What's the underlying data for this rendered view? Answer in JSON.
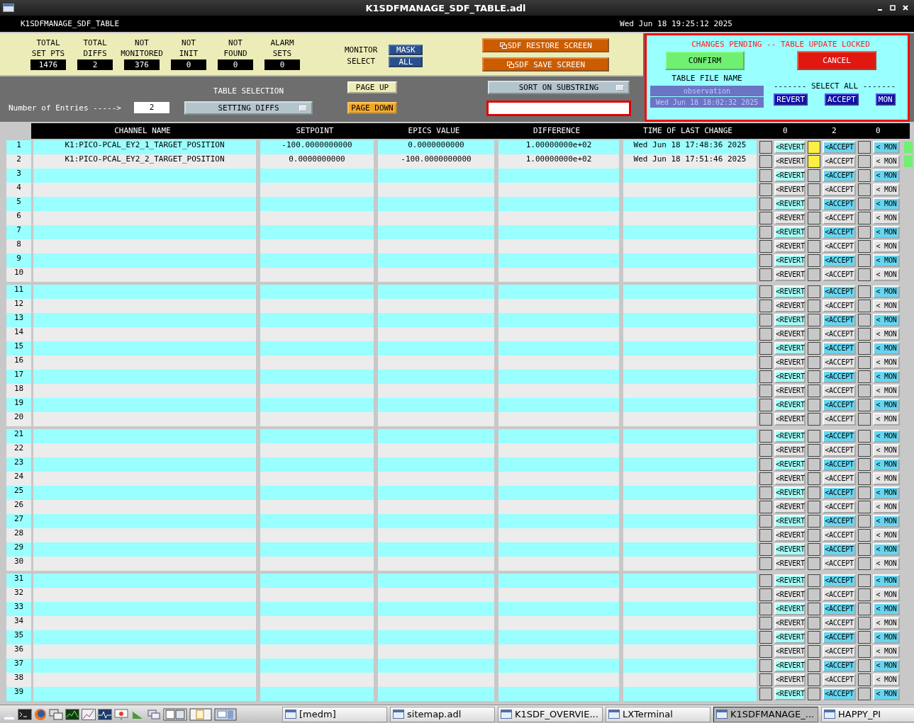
{
  "window": {
    "title": "K1SDFMANAGE_SDF_TABLE.adl"
  },
  "header": {
    "screen_name": "K1SDFMANAGE_SDF_TABLE",
    "clock": "Wed Jun 18 19:25:12 2025"
  },
  "stats": [
    {
      "line1": "TOTAL",
      "line2": "SET PTS",
      "value": "1476"
    },
    {
      "line1": "TOTAL",
      "line2": "DIFFS",
      "value": "2"
    },
    {
      "line1": "NOT",
      "line2": "MONITORED",
      "value": "376"
    },
    {
      "line1": "NOT",
      "line2": "INIT",
      "value": "0"
    },
    {
      "line1": "NOT",
      "line2": "FOUND",
      "value": "0"
    },
    {
      "line1": "ALARM",
      "line2": "SETS",
      "value": "0"
    }
  ],
  "monitor_select": {
    "line1": "MONITOR",
    "line2": "SELECT",
    "buttons": [
      "MASK",
      "ALL"
    ]
  },
  "screen_buttons": [
    "SDF RESTORE SCREEN",
    "SDF SAVE SCREEN"
  ],
  "entries": {
    "label": "Number of Entries ----->",
    "value": "2"
  },
  "table_selection": {
    "label": "TABLE SELECTION",
    "value": "SETTING DIFFS"
  },
  "page_buttons": [
    {
      "label": "PAGE UP",
      "highlighted": false
    },
    {
      "label": "PAGE DOWN",
      "highlighted": true
    }
  ],
  "sort": {
    "label": "SORT ON SUBSTRING"
  },
  "pending": {
    "message": "CHANGES PENDING -- TABLE UPDATE LOCKED",
    "confirm": "CONFIRM",
    "cancel": "CANCEL",
    "file_label": "TABLE FILE NAME",
    "file_name": "observation",
    "file_time": "Wed Jun 18 18:02:32 2025",
    "select_all": "------- SELECT ALL -------",
    "select_buttons": [
      "REVERT",
      "ACCEPT",
      "MON"
    ]
  },
  "table": {
    "columns": [
      "CHANNEL NAME",
      "SETPOINT",
      "EPICS VALUE",
      "DIFFERENCE",
      "TIME OF LAST CHANGE"
    ],
    "counts": [
      "0",
      "2",
      "0"
    ],
    "rows": [
      {
        "num": "1",
        "channel": "K1:PICO-PCAL_EY2_1_TARGET_POSITION",
        "setpoint": "-100.0000000000",
        "epics": "0.0000000000",
        "difference": "1.00000000e+02",
        "time": "Wed Jun 18 17:48:36 2025",
        "revert": "<REVERT",
        "accept": "<ACCEPT",
        "mon": "< MON",
        "revert_checked": false,
        "accept_checked": true,
        "mon_checked": false,
        "status_ok": true
      },
      {
        "num": "2",
        "channel": "K1:PICO-PCAL_EY2_2_TARGET_POSITION",
        "setpoint": "0.0000000000",
        "epics": "-100.0000000000",
        "difference": "1.00000000e+02",
        "time": "Wed Jun 18 17:51:46 2025",
        "revert": "<REVERT",
        "accept": "<ACCEPT",
        "mon": "< MON",
        "revert_checked": false,
        "accept_checked": true,
        "mon_checked": false,
        "status_ok": true
      },
      {
        "num": "3",
        "revert": "<REVERT",
        "accept": "<ACCEPT",
        "mon": "< MON",
        "revert_checked": false,
        "accept_checked": false,
        "mon_checked": false,
        "status_ok": false
      },
      {
        "num": "4",
        "revert": "<REVERT",
        "accept": "<ACCEPT",
        "mon": "< MON",
        "revert_checked": false,
        "accept_checked": false,
        "mon_checked": false,
        "status_ok": false
      },
      {
        "num": "5",
        "revert": "<REVERT",
        "accept": "<ACCEPT",
        "mon": "< MON",
        "revert_checked": false,
        "accept_checked": false,
        "mon_checked": false,
        "status_ok": false
      },
      {
        "num": "6",
        "revert": "<REVERT",
        "accept": "<ACCEPT",
        "mon": "< MON",
        "revert_checked": false,
        "accept_checked": false,
        "mon_checked": false,
        "status_ok": false
      },
      {
        "num": "7",
        "revert": "<REVERT",
        "accept": "<ACCEPT",
        "mon": "< MON",
        "revert_checked": false,
        "accept_checked": false,
        "mon_checked": false,
        "status_ok": false
      },
      {
        "num": "8",
        "revert": "<REVERT",
        "accept": "<ACCEPT",
        "mon": "< MON",
        "revert_checked": false,
        "accept_checked": false,
        "mon_checked": false,
        "status_ok": false
      },
      {
        "num": "9",
        "revert": "<REVERT",
        "accept": "<ACCEPT",
        "mon": "< MON",
        "revert_checked": false,
        "accept_checked": false,
        "mon_checked": false,
        "status_ok": false
      },
      {
        "num": "10",
        "revert": "<REVERT",
        "accept": "<ACCEPT",
        "mon": "< MON",
        "revert_checked": false,
        "accept_checked": false,
        "mon_checked": false,
        "status_ok": false
      },
      {
        "num": "11",
        "revert": "<REVERT",
        "accept": "<ACCEPT",
        "mon": "< MON",
        "revert_checked": false,
        "accept_checked": false,
        "mon_checked": false,
        "status_ok": false
      },
      {
        "num": "12",
        "revert": "<REVERT",
        "accept": "<ACCEPT",
        "mon": "< MON",
        "revert_checked": false,
        "accept_checked": false,
        "mon_checked": false,
        "status_ok": false
      },
      {
        "num": "13",
        "revert": "<REVERT",
        "accept": "<ACCEPT",
        "mon": "< MON",
        "revert_checked": false,
        "accept_checked": false,
        "mon_checked": false,
        "status_ok": false
      },
      {
        "num": "14",
        "revert": "<REVERT",
        "accept": "<ACCEPT",
        "mon": "< MON",
        "revert_checked": false,
        "accept_checked": false,
        "mon_checked": false,
        "status_ok": false
      },
      {
        "num": "15",
        "revert": "<REVERT",
        "accept": "<ACCEPT",
        "mon": "< MON",
        "revert_checked": false,
        "accept_checked": false,
        "mon_checked": false,
        "status_ok": false
      },
      {
        "num": "16",
        "revert": "<REVERT",
        "accept": "<ACCEPT",
        "mon": "< MON",
        "revert_checked": false,
        "accept_checked": false,
        "mon_checked": false,
        "status_ok": false
      },
      {
        "num": "17",
        "revert": "<REVERT",
        "accept": "<ACCEPT",
        "mon": "< MON",
        "revert_checked": false,
        "accept_checked": false,
        "mon_checked": false,
        "status_ok": false
      },
      {
        "num": "18",
        "revert": "<REVERT",
        "accept": "<ACCEPT",
        "mon": "< MON",
        "revert_checked": false,
        "accept_checked": false,
        "mon_checked": false,
        "status_ok": false
      },
      {
        "num": "19",
        "revert": "<REVERT",
        "accept": "<ACCEPT",
        "mon": "< MON",
        "revert_checked": false,
        "accept_checked": false,
        "mon_checked": false,
        "status_ok": false
      },
      {
        "num": "20",
        "revert": "<REVERT",
        "accept": "<ACCEPT",
        "mon": "< MON",
        "revert_checked": false,
        "accept_checked": false,
        "mon_checked": false,
        "status_ok": false
      },
      {
        "num": "21",
        "revert": "<REVERT",
        "accept": "<ACCEPT",
        "mon": "< MON",
        "revert_checked": false,
        "accept_checked": false,
        "mon_checked": false,
        "status_ok": false
      },
      {
        "num": "22",
        "revert": "<REVERT",
        "accept": "<ACCEPT",
        "mon": "< MON",
        "revert_checked": false,
        "accept_checked": false,
        "mon_checked": false,
        "status_ok": false
      },
      {
        "num": "23",
        "revert": "<REVERT",
        "accept": "<ACCEPT",
        "mon": "< MON",
        "revert_checked": false,
        "accept_checked": false,
        "mon_checked": false,
        "status_ok": false
      },
      {
        "num": "24",
        "revert": "<REVERT",
        "accept": "<ACCEPT",
        "mon": "< MON",
        "revert_checked": false,
        "accept_checked": false,
        "mon_checked": false,
        "status_ok": false
      },
      {
        "num": "25",
        "revert": "<REVERT",
        "accept": "<ACCEPT",
        "mon": "< MON",
        "revert_checked": false,
        "accept_checked": false,
        "mon_checked": false,
        "status_ok": false
      },
      {
        "num": "26",
        "revert": "<REVERT",
        "accept": "<ACCEPT",
        "mon": "< MON",
        "revert_checked": false,
        "accept_checked": false,
        "mon_checked": false,
        "status_ok": false
      },
      {
        "num": "27",
        "revert": "<REVERT",
        "accept": "<ACCEPT",
        "mon": "< MON",
        "revert_checked": false,
        "accept_checked": false,
        "mon_checked": false,
        "status_ok": false
      },
      {
        "num": "28",
        "revert": "<REVERT",
        "accept": "<ACCEPT",
        "mon": "< MON",
        "revert_checked": false,
        "accept_checked": false,
        "mon_checked": false,
        "status_ok": false
      },
      {
        "num": "29",
        "revert": "<REVERT",
        "accept": "<ACCEPT",
        "mon": "< MON",
        "revert_checked": false,
        "accept_checked": false,
        "mon_checked": false,
        "status_ok": false
      },
      {
        "num": "30",
        "revert": "<REVERT",
        "accept": "<ACCEPT",
        "mon": "< MON",
        "revert_checked": false,
        "accept_checked": false,
        "mon_checked": false,
        "status_ok": false
      },
      {
        "num": "31",
        "revert": "<REVERT",
        "accept": "<ACCEPT",
        "mon": "< MON",
        "revert_checked": false,
        "accept_checked": false,
        "mon_checked": false,
        "status_ok": false
      },
      {
        "num": "32",
        "revert": "<REVERT",
        "accept": "<ACCEPT",
        "mon": "< MON",
        "revert_checked": false,
        "accept_checked": false,
        "mon_checked": false,
        "status_ok": false
      },
      {
        "num": "33",
        "revert": "<REVERT",
        "accept": "<ACCEPT",
        "mon": "< MON",
        "revert_checked": false,
        "accept_checked": false,
        "mon_checked": false,
        "status_ok": false
      },
      {
        "num": "34",
        "revert": "<REVERT",
        "accept": "<ACCEPT",
        "mon": "< MON",
        "revert_checked": false,
        "accept_checked": false,
        "mon_checked": false,
        "status_ok": false
      },
      {
        "num": "35",
        "revert": "<REVERT",
        "accept": "<ACCEPT",
        "mon": "< MON",
        "revert_checked": false,
        "accept_checked": false,
        "mon_checked": false,
        "status_ok": false
      },
      {
        "num": "36",
        "revert": "<REVERT",
        "accept": "<ACCEPT",
        "mon": "< MON",
        "revert_checked": false,
        "accept_checked": false,
        "mon_checked": false,
        "status_ok": false
      },
      {
        "num": "37",
        "revert": "<REVERT",
        "accept": "<ACCEPT",
        "mon": "< MON",
        "revert_checked": false,
        "accept_checked": false,
        "mon_checked": false,
        "status_ok": false
      },
      {
        "num": "38",
        "revert": "<REVERT",
        "accept": "<ACCEPT",
        "mon": "< MON",
        "revert_checked": false,
        "accept_checked": false,
        "mon_checked": false,
        "status_ok": false
      },
      {
        "num": "39",
        "revert": "<REVERT",
        "accept": "<ACCEPT",
        "mon": "< MON",
        "revert_checked": false,
        "accept_checked": false,
        "mon_checked": false,
        "status_ok": false
      }
    ]
  },
  "taskbar": {
    "windows": [
      {
        "label": "[medm]",
        "selected": false
      },
      {
        "label": "sitemap.adl",
        "selected": false
      },
      {
        "label": "K1SDF_OVERVIE...",
        "selected": false
      },
      {
        "label": "LXTerminal",
        "selected": false
      },
      {
        "label": "K1SDFMANAGE_...",
        "selected": true
      },
      {
        "label": "HAPPY_PI",
        "selected": false
      }
    ]
  }
}
